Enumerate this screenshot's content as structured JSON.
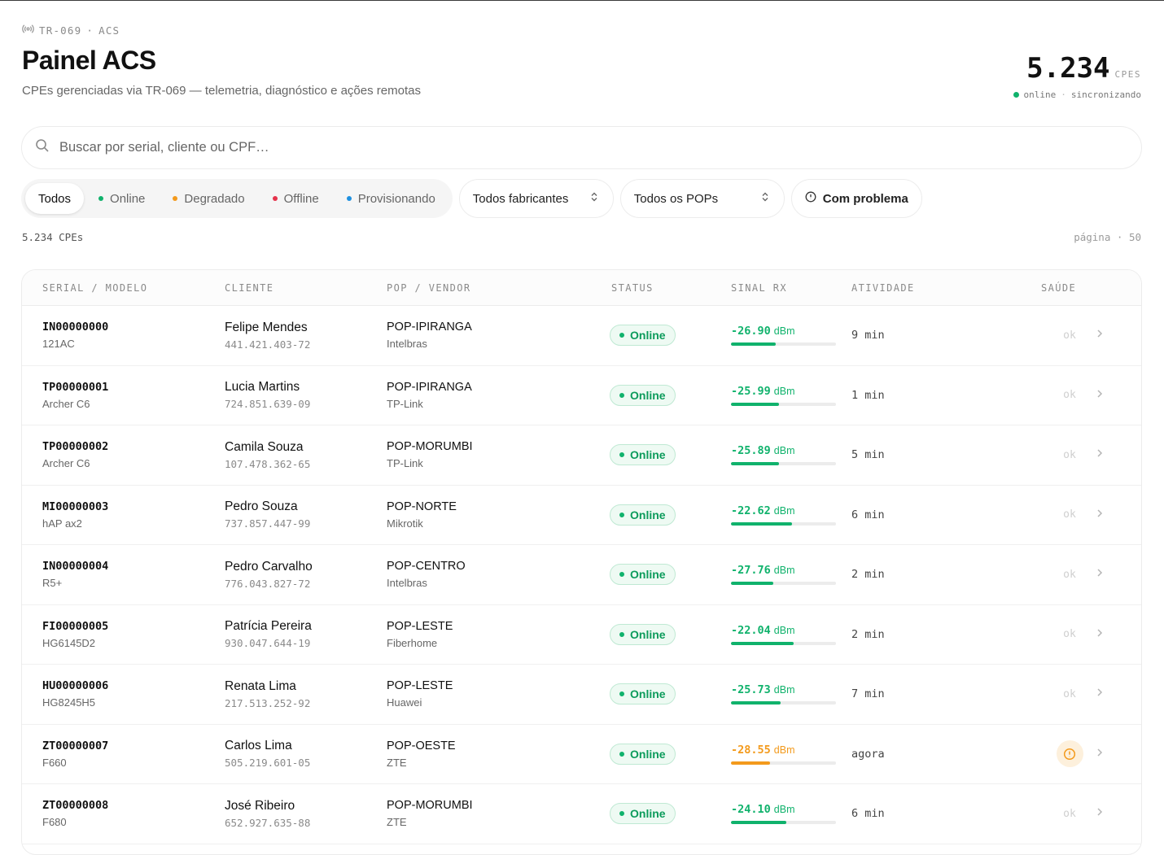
{
  "header": {
    "eyebrow_code": "TR-069",
    "eyebrow_sep": "·",
    "eyebrow_name": "ACS",
    "title": "Painel ACS",
    "subtitle": "CPEs gerenciadas via TR-069 — telemetria, diagnóstico e ações remotas",
    "count": "5.234",
    "count_unit": "CPES",
    "status_online": "online",
    "status_sep": "·",
    "status_sync": "sincronizando"
  },
  "search": {
    "placeholder": "Buscar por serial, cliente ou CPF…",
    "icon": "search-icon"
  },
  "filters": {
    "status_tabs": [
      {
        "label": "Todos",
        "color": ""
      },
      {
        "label": "Online",
        "color": "#10b26c"
      },
      {
        "label": "Degradado",
        "color": "#f39a1c"
      },
      {
        "label": "Offline",
        "color": "#e5334b"
      },
      {
        "label": "Provisionando",
        "color": "#1e90e0"
      }
    ],
    "vendor_select": "Todos fabricantes",
    "pop_select": "Todos os POPs",
    "problem_toggle": "Com problema"
  },
  "meta": {
    "total": "5.234 CPEs",
    "page_label": "página",
    "page_sep": "·",
    "page_size": "50"
  },
  "table": {
    "columns": [
      "SERIAL / MODELO",
      "CLIENTE",
      "POP / VENDOR",
      "STATUS",
      "SINAL RX",
      "ATIVIDADE",
      "SAÚDE"
    ],
    "rows": [
      {
        "serial": "IN00000000",
        "model": "121AC",
        "client": "Felipe Mendes",
        "cpf": "441.421.403-72",
        "pop": "POP-IPIRANGA",
        "vendor": "Intelbras",
        "status": "Online",
        "signal": "-26.90",
        "unit": "dBm",
        "signal_level": 0.43,
        "signal_color": "#10b26c",
        "activity": "9 min",
        "health": "ok"
      },
      {
        "serial": "TP00000001",
        "model": "Archer C6",
        "client": "Lucia Martins",
        "cpf": "724.851.639-09",
        "pop": "POP-IPIRANGA",
        "vendor": "TP-Link",
        "status": "Online",
        "signal": "-25.99",
        "unit": "dBm",
        "signal_level": 0.46,
        "signal_color": "#10b26c",
        "activity": "1 min",
        "health": "ok"
      },
      {
        "serial": "TP00000002",
        "model": "Archer C6",
        "client": "Camila Souza",
        "cpf": "107.478.362-65",
        "pop": "POP-MORUMBI",
        "vendor": "TP-Link",
        "status": "Online",
        "signal": "-25.89",
        "unit": "dBm",
        "signal_level": 0.46,
        "signal_color": "#10b26c",
        "activity": "5 min",
        "health": "ok"
      },
      {
        "serial": "MI00000003",
        "model": "hAP ax2",
        "client": "Pedro Souza",
        "cpf": "737.857.447-99",
        "pop": "POP-NORTE",
        "vendor": "Mikrotik",
        "status": "Online",
        "signal": "-22.62",
        "unit": "dBm",
        "signal_level": 0.58,
        "signal_color": "#10b26c",
        "activity": "6 min",
        "health": "ok"
      },
      {
        "serial": "IN00000004",
        "model": "R5+",
        "client": "Pedro Carvalho",
        "cpf": "776.043.827-72",
        "pop": "POP-CENTRO",
        "vendor": "Intelbras",
        "status": "Online",
        "signal": "-27.76",
        "unit": "dBm",
        "signal_level": 0.4,
        "signal_color": "#10b26c",
        "activity": "2 min",
        "health": "ok"
      },
      {
        "serial": "FI00000005",
        "model": "HG6145D2",
        "client": "Patrícia Pereira",
        "cpf": "930.047.644-19",
        "pop": "POP-LESTE",
        "vendor": "Fiberhome",
        "status": "Online",
        "signal": "-22.04",
        "unit": "dBm",
        "signal_level": 0.6,
        "signal_color": "#10b26c",
        "activity": "2 min",
        "health": "ok"
      },
      {
        "serial": "HU00000006",
        "model": "HG8245H5",
        "client": "Renata Lima",
        "cpf": "217.513.252-92",
        "pop": "POP-LESTE",
        "vendor": "Huawei",
        "status": "Online",
        "signal": "-25.73",
        "unit": "dBm",
        "signal_level": 0.47,
        "signal_color": "#10b26c",
        "activity": "7 min",
        "health": "ok"
      },
      {
        "serial": "ZT00000007",
        "model": "F660",
        "client": "Carlos Lima",
        "cpf": "505.219.601-05",
        "pop": "POP-OESTE",
        "vendor": "ZTE",
        "status": "Online",
        "signal": "-28.55",
        "unit": "dBm",
        "signal_level": 0.37,
        "signal_color": "#f39a1c",
        "activity": "agora",
        "health": ""
      },
      {
        "serial": "ZT00000008",
        "model": "F680",
        "client": "José Ribeiro",
        "cpf": "652.927.635-88",
        "pop": "POP-MORUMBI",
        "vendor": "ZTE",
        "status": "Online",
        "signal": "-24.10",
        "unit": "dBm",
        "signal_level": 0.53,
        "signal_color": "#10b26c",
        "activity": "6 min",
        "health": "ok"
      }
    ]
  }
}
